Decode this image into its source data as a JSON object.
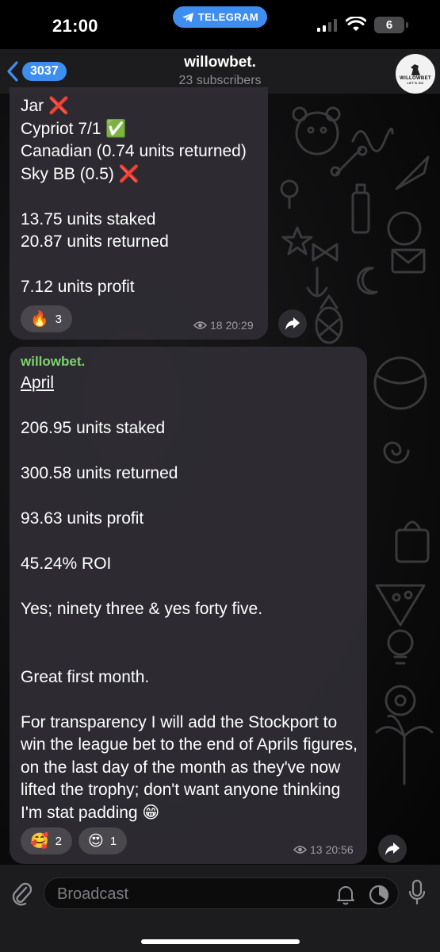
{
  "status_bar": {
    "time": "21:00",
    "telegram_label": "TELEGRAM",
    "battery": "6"
  },
  "header": {
    "back_count": "3037",
    "title": "willowbet.",
    "subscribers": "23 subscribers",
    "avatar_text": "WILLOWBET",
    "avatar_subtext": "LET'S GO"
  },
  "messages": [
    {
      "lines": [
        "Jar ❌",
        "Cypriot 7/1 ✅",
        "Canadian (0.74 units returned)",
        "Sky BB (0.5) ❌",
        "",
        "13.75 units staked",
        "20.87 units returned",
        "",
        "7.12 units profit"
      ],
      "reactions": [
        {
          "emoji": "🔥",
          "count": "3"
        }
      ],
      "views": "18",
      "time": "20:29"
    },
    {
      "sender": "willowbet.",
      "heading": "April",
      "lines": [
        "206.95 units staked",
        "300.58 units returned",
        "93.63 units profit",
        "45.24% ROI",
        "Yes; ninety three & yes forty five.",
        "Great first month.",
        "For transparency I will add the Stockport to win the league bet to the end of Aprils figures, on the last day of the month as they've now lifted the trophy; don't want anyone thinking I'm stat padding 😁"
      ],
      "reactions": [
        {
          "emoji": "🥰",
          "count": "2"
        },
        {
          "emoji": "😍",
          "count": "1"
        }
      ],
      "views": "13",
      "time": "20:56"
    }
  ],
  "composer": {
    "placeholder": "Broadcast"
  },
  "icons": {
    "attach": "paperclip-icon",
    "bell": "bell-icon",
    "timer": "timer-icon",
    "mic": "microphone-icon",
    "share": "share-arrow-icon",
    "views": "eye-icon"
  },
  "colors": {
    "accent": "#3d8ef0",
    "sender_name": "#7ed46b",
    "bubble": "#302e34"
  }
}
